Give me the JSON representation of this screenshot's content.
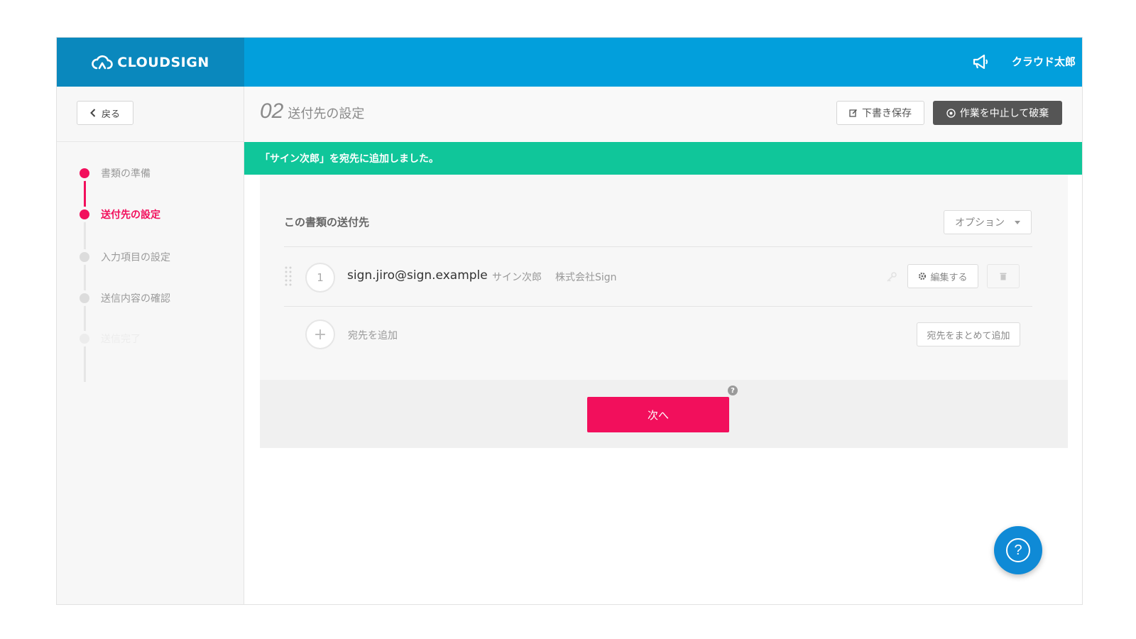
{
  "header": {
    "logo_text": "CLOUDSIGN",
    "user_name": "クラウド太郎",
    "megaphone_icon": "megaphone-icon"
  },
  "sidebar": {
    "back_label": "戻る",
    "steps": [
      {
        "label": "書類の準備",
        "state": "done"
      },
      {
        "label": "送付先の設定",
        "state": "active"
      },
      {
        "label": "入力項目の設定",
        "state": "pending"
      },
      {
        "label": "送信内容の確認",
        "state": "pending"
      },
      {
        "label": "送信完了",
        "state": "future"
      }
    ]
  },
  "main": {
    "step_number": "02",
    "step_title": "送付先の設定",
    "draft_button": "下書き保存",
    "abort_button": "作業を中止して破棄",
    "notice": "「サイン次郎」を宛先に追加しました。",
    "card": {
      "title": "この書類の送付先",
      "option_button": "オプション",
      "recipients": [
        {
          "number": "1",
          "email": "sign.jiro@sign.example",
          "name": "サイン次郎",
          "company": "株式会社Sign",
          "edit_label": "編集する"
        }
      ],
      "add_label": "宛先を追加",
      "bulk_add_button": "宛先をまとめて追加"
    },
    "next_button": "次へ",
    "help_dot": "?",
    "help_fab": "?"
  },
  "colors": {
    "header": "#029fdc",
    "logo_bg": "#0a88bd",
    "accent_pink": "#f20f5c",
    "notice_green": "#10c69a",
    "abort_bg": "#555555"
  }
}
